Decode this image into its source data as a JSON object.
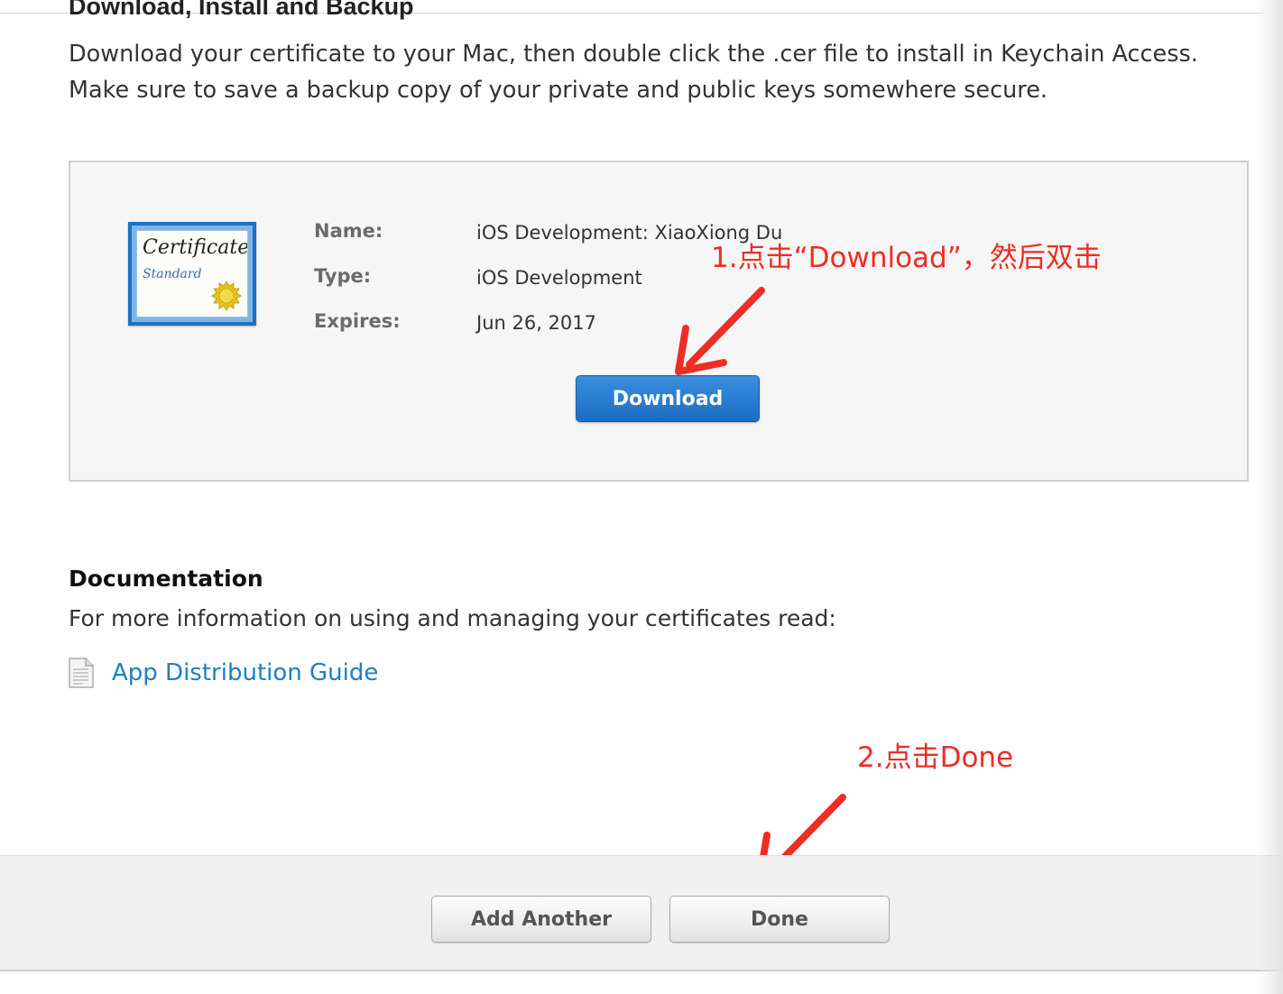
{
  "section": {
    "heading": "Download, Install and Backup",
    "description": "Download your certificate to your Mac, then double click the .cer file to install in Keychain Access. Make sure to save a backup copy of your private and public keys somewhere secure."
  },
  "certificate": {
    "icon_title": "Certificate",
    "icon_subtitle": "Standard",
    "fields": [
      {
        "label": "Name:",
        "value": "iOS Development: XiaoXiong Du"
      },
      {
        "label": "Type:",
        "value": "iOS Development"
      },
      {
        "label": "Expires:",
        "value": "Jun 26, 2017"
      }
    ],
    "download_label": "Download"
  },
  "documentation": {
    "heading": "Documentation",
    "text": "For more information on using and managing your certificates read:",
    "link_label": "App Distribution Guide"
  },
  "annotations": {
    "step1": "1.点击“Download”，然后双击",
    "step2": "2.点击Done",
    "color": "#ee2d24"
  },
  "footer": {
    "add_another_label": "Add Another",
    "done_label": "Done"
  },
  "colors": {
    "link": "#1a7fc9",
    "primary_button": "#1f74c9",
    "annotation": "#ee2d24"
  }
}
